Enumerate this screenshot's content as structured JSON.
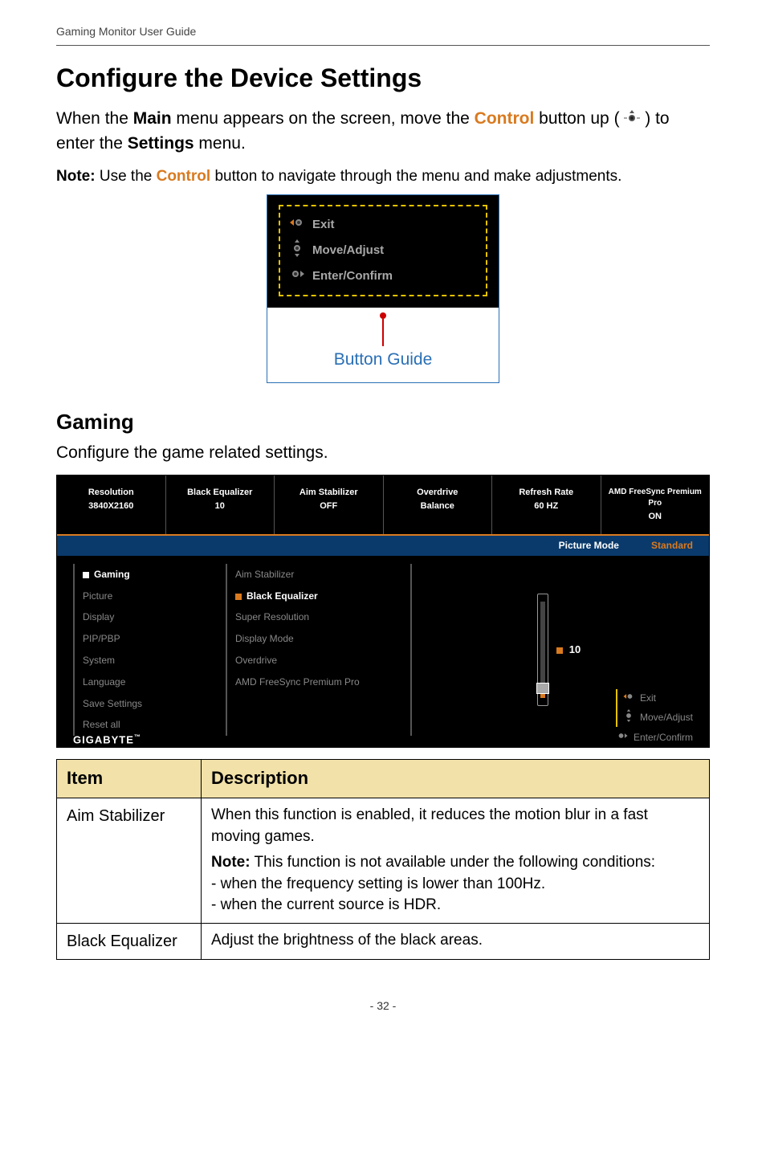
{
  "header": {
    "doc_title": "Gaming Monitor User Guide"
  },
  "title": "Configure the Device Settings",
  "intro": {
    "pre": "When the ",
    "main": "Main",
    "mid1": " menu appears on the screen, move the ",
    "control": "Control",
    "mid2": " button up (",
    "post": ") to enter the ",
    "settings": "Settings",
    "end": " menu."
  },
  "note": {
    "label": "Note:",
    "pre": " Use the ",
    "control": "Control",
    "post": " button to navigate through the menu and make adjustments."
  },
  "button_guide": {
    "exit": "Exit",
    "move": "Move/Adjust",
    "enter": "Enter/Confirm",
    "caption": "Button Guide"
  },
  "section": {
    "heading": "Gaming",
    "intro": "Configure the game related settings."
  },
  "osd": {
    "status": [
      {
        "t1": "Resolution",
        "t2": "3840X2160"
      },
      {
        "t1": "Black Equalizer",
        "t2": "10"
      },
      {
        "t1": "Aim Stabilizer",
        "t2": "OFF"
      },
      {
        "t1": "Overdrive",
        "t2": "Balance"
      },
      {
        "t1": "Refresh Rate",
        "t2": "60 HZ"
      },
      {
        "t1": "AMD FreeSync Premium Pro",
        "t2": "ON"
      }
    ],
    "bar": {
      "mode_label": "Picture Mode",
      "mode_value": "Standard"
    },
    "menu_main": [
      {
        "label": "Gaming",
        "active": true
      },
      {
        "label": "Picture"
      },
      {
        "label": "Display"
      },
      {
        "label": "PIP/PBP"
      },
      {
        "label": "System"
      },
      {
        "label": "Language"
      },
      {
        "label": "Save Settings"
      },
      {
        "label": "Reset all"
      }
    ],
    "menu_sub": [
      {
        "label": "Aim Stabilizer"
      },
      {
        "label": "Black Equalizer",
        "sel": true
      },
      {
        "label": "Super Resolution"
      },
      {
        "label": "Display Mode"
      },
      {
        "label": "Overdrive"
      },
      {
        "label": "AMD FreeSync Premium Pro"
      }
    ],
    "slider_value": "10",
    "guide": {
      "exit": "Exit",
      "move": "Move/Adjust",
      "enter": "Enter/Confirm"
    },
    "logo": "GIGABYTE"
  },
  "table": {
    "h_item": "Item",
    "h_desc": "Description",
    "rows": [
      {
        "item": "Aim Stabilizer",
        "desc_line1": "When this function is enabled, it reduces the motion blur in a fast moving games.",
        "note_label": "Note:",
        "note_text": " This function is not available under the following conditions:",
        "bullet1": "- when the frequency setting is lower than 100Hz.",
        "bullet2": "- when the current source is HDR."
      },
      {
        "item": "Black Equalizer",
        "desc_line1": "Adjust the brightness of the black areas."
      }
    ]
  },
  "page_num": "- 32 -"
}
